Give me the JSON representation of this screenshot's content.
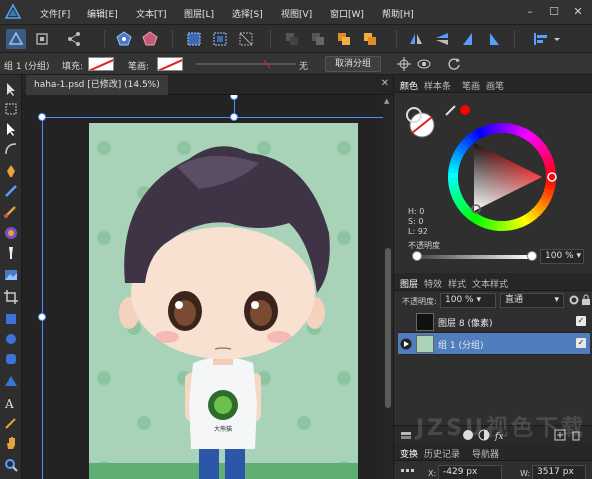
{
  "menubar": {
    "items": [
      "文件[F]",
      "编辑[E]",
      "文本[T]",
      "图层[L]",
      "选择[S]",
      "视图[V]",
      "窗口[W]",
      "帮助[H]"
    ],
    "window_controls": [
      "–",
      "☐",
      "✕"
    ]
  },
  "context": {
    "selection_label": "组 1 (分组)",
    "fill_label": "填充:",
    "stroke_label": "笔画:",
    "stroke_none_label": "无",
    "ungroup_label": "取消分组"
  },
  "document": {
    "tab_title": "haha-1.psd [已修改] (14.5%)",
    "close": "✕"
  },
  "color_panel": {
    "tabs": [
      "颜色",
      "样本条",
      "笔画",
      "画笔"
    ],
    "h_label": "H: 0",
    "s_label": "S: 0",
    "l_label": "L: 92",
    "opacity_label": "不透明度",
    "opacity_value": "100 %",
    "opacity": 1.0,
    "current_hue_color": "#ff0000",
    "ring_colors": [
      "#ff0000",
      "#ffff00",
      "#00ff00",
      "#00ffff",
      "#0000ff",
      "#ff00ff",
      "#ff0000"
    ]
  },
  "layers_panel": {
    "tabs": [
      "图层",
      "特效",
      "样式",
      "文本样式"
    ],
    "opacity_label": "不透明度:",
    "opacity_value": "100 %",
    "blend_mode": "直通",
    "layers": [
      {
        "name": "图层 8 (像素)",
        "selected": false,
        "checked": "✓"
      },
      {
        "name": "组 1 (分组)",
        "selected": true,
        "checked": "✓"
      }
    ]
  },
  "transform_panel": {
    "tabs": [
      "变换",
      "历史记录",
      "导航器"
    ],
    "x_label": "X:",
    "x_value": "-429 px",
    "w_label": "W:",
    "w_value": "3517 px"
  },
  "artwork_shirt_text": "大熊猫",
  "watermark": "JZSU视色下载",
  "colors": {
    "canvas_bg": "#a8d3b8",
    "dot": "#8ec5a1",
    "selection": "#4b8cff",
    "accent_blue": "#4f7dbd"
  }
}
